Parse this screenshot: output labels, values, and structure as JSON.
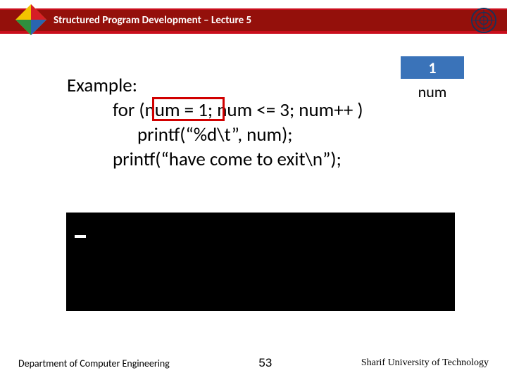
{
  "header": {
    "title": "Structured Program Development – Lecture 5"
  },
  "value_box": {
    "value": "1",
    "label": "num"
  },
  "code": {
    "example_label": "Example:",
    "line1": "for (num = 1; num <= 3; num++ )",
    "line2": "printf(“%d\\t”, num);",
    "line3": "printf(“have come to exit\\n”);"
  },
  "console": {
    "output": ""
  },
  "footer": {
    "left": "Department of Computer Engineering",
    "center": "53",
    "right": "Sharif University of Technology"
  },
  "colors": {
    "accent_red": "#c90e1c",
    "box_blue": "#3a73b9",
    "highlight_border": "#d10000"
  }
}
